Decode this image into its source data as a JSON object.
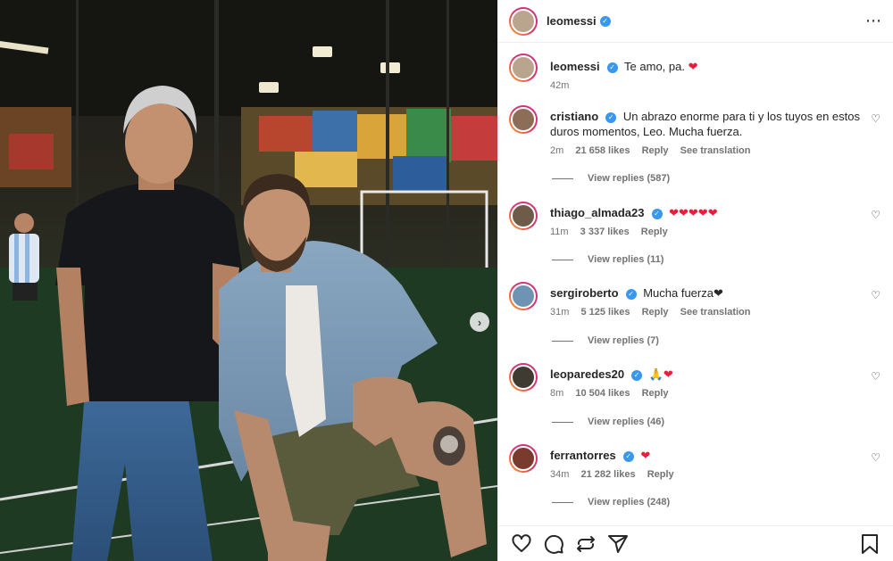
{
  "post": {
    "author": "leomessi",
    "author_verified": true,
    "more_icon": "more-horizontal-icon"
  },
  "caption": {
    "username": "leomessi",
    "text": "Te amo, pa.",
    "emoji": "❤",
    "time": "42m"
  },
  "comments": [
    {
      "username": "cristiano",
      "text": "Un abrazo enorme para ti y los tuyos en estos duros momentos, Leo. Mucha fuerza.",
      "time": "2m",
      "likes": "21 658 likes",
      "reply_label": "Reply",
      "translation_label": "See translation",
      "view_replies": "View replies (587)"
    },
    {
      "username": "thiago_almada23",
      "text": "❤❤❤❤❤",
      "time": "11m",
      "likes": "3 337 likes",
      "reply_label": "Reply",
      "view_replies": "View replies (11)"
    },
    {
      "username": "sergiroberto",
      "text": "Mucha fuerza❤",
      "time": "31m",
      "likes": "5 125 likes",
      "reply_label": "Reply",
      "translation_label": "See translation",
      "view_replies": "View replies (7)"
    },
    {
      "username": "leoparedes20",
      "text": "🙏❤",
      "time": "8m",
      "likes": "10 504 likes",
      "reply_label": "Reply",
      "view_replies": "View replies (46)"
    },
    {
      "username": "ferrantorres",
      "text": "❤",
      "time": "34m",
      "likes": "21 282 likes",
      "reply_label": "Reply",
      "view_replies": "View replies (248)"
    }
  ],
  "colors": {
    "verified": "#3897f0",
    "heart": "#ed1c3c",
    "meta": "#737373"
  },
  "action_icons": [
    "heart-icon",
    "comment-icon",
    "repost-icon",
    "share-icon",
    "bookmark-icon"
  ]
}
